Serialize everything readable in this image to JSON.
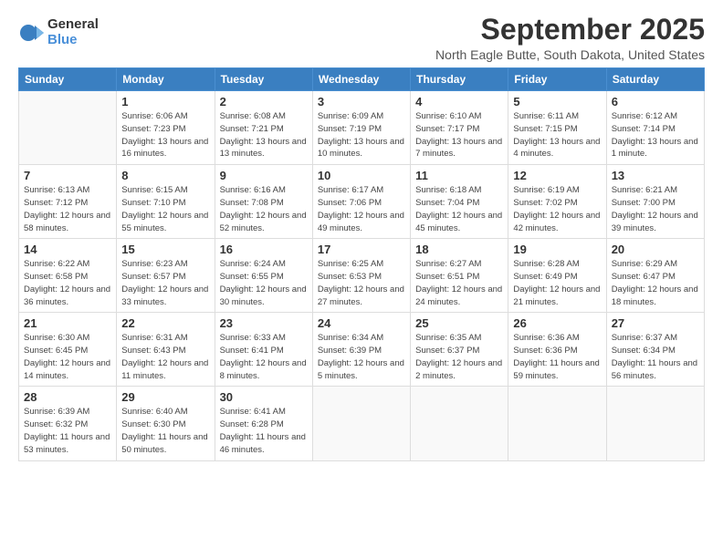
{
  "logo": {
    "general": "General",
    "blue": "Blue"
  },
  "title": "September 2025",
  "location": "North Eagle Butte, South Dakota, United States",
  "days_header": [
    "Sunday",
    "Monday",
    "Tuesday",
    "Wednesday",
    "Thursday",
    "Friday",
    "Saturday"
  ],
  "weeks": [
    [
      {
        "num": "",
        "info": ""
      },
      {
        "num": "1",
        "info": "Sunrise: 6:06 AM\nSunset: 7:23 PM\nDaylight: 13 hours\nand 16 minutes."
      },
      {
        "num": "2",
        "info": "Sunrise: 6:08 AM\nSunset: 7:21 PM\nDaylight: 13 hours\nand 13 minutes."
      },
      {
        "num": "3",
        "info": "Sunrise: 6:09 AM\nSunset: 7:19 PM\nDaylight: 13 hours\nand 10 minutes."
      },
      {
        "num": "4",
        "info": "Sunrise: 6:10 AM\nSunset: 7:17 PM\nDaylight: 13 hours\nand 7 minutes."
      },
      {
        "num": "5",
        "info": "Sunrise: 6:11 AM\nSunset: 7:15 PM\nDaylight: 13 hours\nand 4 minutes."
      },
      {
        "num": "6",
        "info": "Sunrise: 6:12 AM\nSunset: 7:14 PM\nDaylight: 13 hours\nand 1 minute."
      }
    ],
    [
      {
        "num": "7",
        "info": "Sunrise: 6:13 AM\nSunset: 7:12 PM\nDaylight: 12 hours\nand 58 minutes."
      },
      {
        "num": "8",
        "info": "Sunrise: 6:15 AM\nSunset: 7:10 PM\nDaylight: 12 hours\nand 55 minutes."
      },
      {
        "num": "9",
        "info": "Sunrise: 6:16 AM\nSunset: 7:08 PM\nDaylight: 12 hours\nand 52 minutes."
      },
      {
        "num": "10",
        "info": "Sunrise: 6:17 AM\nSunset: 7:06 PM\nDaylight: 12 hours\nand 49 minutes."
      },
      {
        "num": "11",
        "info": "Sunrise: 6:18 AM\nSunset: 7:04 PM\nDaylight: 12 hours\nand 45 minutes."
      },
      {
        "num": "12",
        "info": "Sunrise: 6:19 AM\nSunset: 7:02 PM\nDaylight: 12 hours\nand 42 minutes."
      },
      {
        "num": "13",
        "info": "Sunrise: 6:21 AM\nSunset: 7:00 PM\nDaylight: 12 hours\nand 39 minutes."
      }
    ],
    [
      {
        "num": "14",
        "info": "Sunrise: 6:22 AM\nSunset: 6:58 PM\nDaylight: 12 hours\nand 36 minutes."
      },
      {
        "num": "15",
        "info": "Sunrise: 6:23 AM\nSunset: 6:57 PM\nDaylight: 12 hours\nand 33 minutes."
      },
      {
        "num": "16",
        "info": "Sunrise: 6:24 AM\nSunset: 6:55 PM\nDaylight: 12 hours\nand 30 minutes."
      },
      {
        "num": "17",
        "info": "Sunrise: 6:25 AM\nSunset: 6:53 PM\nDaylight: 12 hours\nand 27 minutes."
      },
      {
        "num": "18",
        "info": "Sunrise: 6:27 AM\nSunset: 6:51 PM\nDaylight: 12 hours\nand 24 minutes."
      },
      {
        "num": "19",
        "info": "Sunrise: 6:28 AM\nSunset: 6:49 PM\nDaylight: 12 hours\nand 21 minutes."
      },
      {
        "num": "20",
        "info": "Sunrise: 6:29 AM\nSunset: 6:47 PM\nDaylight: 12 hours\nand 18 minutes."
      }
    ],
    [
      {
        "num": "21",
        "info": "Sunrise: 6:30 AM\nSunset: 6:45 PM\nDaylight: 12 hours\nand 14 minutes."
      },
      {
        "num": "22",
        "info": "Sunrise: 6:31 AM\nSunset: 6:43 PM\nDaylight: 12 hours\nand 11 minutes."
      },
      {
        "num": "23",
        "info": "Sunrise: 6:33 AM\nSunset: 6:41 PM\nDaylight: 12 hours\nand 8 minutes."
      },
      {
        "num": "24",
        "info": "Sunrise: 6:34 AM\nSunset: 6:39 PM\nDaylight: 12 hours\nand 5 minutes."
      },
      {
        "num": "25",
        "info": "Sunrise: 6:35 AM\nSunset: 6:37 PM\nDaylight: 12 hours\nand 2 minutes."
      },
      {
        "num": "26",
        "info": "Sunrise: 6:36 AM\nSunset: 6:36 PM\nDaylight: 11 hours\nand 59 minutes."
      },
      {
        "num": "27",
        "info": "Sunrise: 6:37 AM\nSunset: 6:34 PM\nDaylight: 11 hours\nand 56 minutes."
      }
    ],
    [
      {
        "num": "28",
        "info": "Sunrise: 6:39 AM\nSunset: 6:32 PM\nDaylight: 11 hours\nand 53 minutes."
      },
      {
        "num": "29",
        "info": "Sunrise: 6:40 AM\nSunset: 6:30 PM\nDaylight: 11 hours\nand 50 minutes."
      },
      {
        "num": "30",
        "info": "Sunrise: 6:41 AM\nSunset: 6:28 PM\nDaylight: 11 hours\nand 46 minutes."
      },
      {
        "num": "",
        "info": ""
      },
      {
        "num": "",
        "info": ""
      },
      {
        "num": "",
        "info": ""
      },
      {
        "num": "",
        "info": ""
      }
    ]
  ]
}
